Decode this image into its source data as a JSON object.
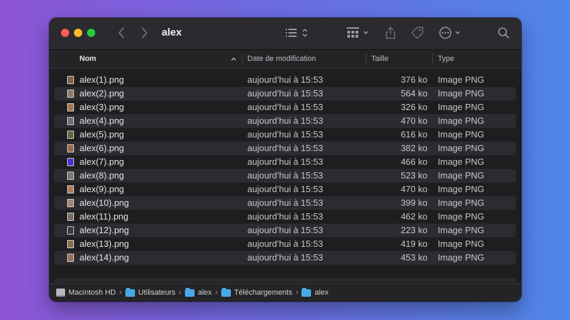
{
  "window": {
    "title": "alex"
  },
  "columns": {
    "name": "Nom",
    "date": "Date de modification",
    "size": "Taille",
    "type": "Type"
  },
  "files": [
    {
      "name": "alex(1).png",
      "date": "aujourd’hui à 15:53",
      "size": "376 ko",
      "type": "Image PNG",
      "thumb": "#8a5b4a"
    },
    {
      "name": "alex(2).png",
      "date": "aujourd’hui à 15:53",
      "size": "564 ko",
      "type": "Image PNG",
      "thumb": "#8d7a6a"
    },
    {
      "name": "alex(3).png",
      "date": "aujourd’hui à 15:53",
      "size": "326 ko",
      "type": "Image PNG",
      "thumb": "#a07850"
    },
    {
      "name": "alex(4).png",
      "date": "aujourd’hui à 15:53",
      "size": "470 ko",
      "type": "Image PNG",
      "thumb": "#6f6f6f"
    },
    {
      "name": "alex(5).png",
      "date": "aujourd’hui à 15:53",
      "size": "616 ko",
      "type": "Image PNG",
      "thumb": "#5a6b3f"
    },
    {
      "name": "alex(6).png",
      "date": "aujourd’hui à 15:53",
      "size": "382 ko",
      "type": "Image PNG",
      "thumb": "#9a6a50"
    },
    {
      "name": "alex(7).png",
      "date": "aujourd’hui à 15:53",
      "size": "466 ko",
      "type": "Image PNG",
      "thumb": "#4b2fd0"
    },
    {
      "name": "alex(8).png",
      "date": "aujourd’hui à 15:53",
      "size": "523 ko",
      "type": "Image PNG",
      "thumb": "#6e7d6a"
    },
    {
      "name": "alex(9).png",
      "date": "aujourd’hui à 15:53",
      "size": "470 ko",
      "type": "Image PNG",
      "thumb": "#b07a58"
    },
    {
      "name": "alex(10).png",
      "date": "aujourd’hui à 15:53",
      "size": "399 ko",
      "type": "Image PNG",
      "thumb": "#a08670"
    },
    {
      "name": "alex(11).png",
      "date": "aujourd’hui à 15:53",
      "size": "462 ko",
      "type": "Image PNG",
      "thumb": "#7d6c62"
    },
    {
      "name": "alex(12).png",
      "date": "aujourd’hui à 15:53",
      "size": "223 ko",
      "type": "Image PNG",
      "thumb": "#3a3a3a"
    },
    {
      "name": "alex(13).png",
      "date": "aujourd’hui à 15:53",
      "size": "419 ko",
      "type": "Image PNG",
      "thumb": "#8b6a52"
    },
    {
      "name": "alex(14).png",
      "date": "aujourd’hui à 15:53",
      "size": "453 ko",
      "type": "Image PNG",
      "thumb": "#97705a"
    }
  ],
  "path": [
    "Macintosh HD",
    "Utilisateurs",
    "alex",
    "Téléchargements",
    "alex"
  ],
  "colors": {
    "background_left": "#8d55d6",
    "background_right": "#4f86e8",
    "window": "#1e1e21",
    "folder": "#4aa8e6"
  }
}
